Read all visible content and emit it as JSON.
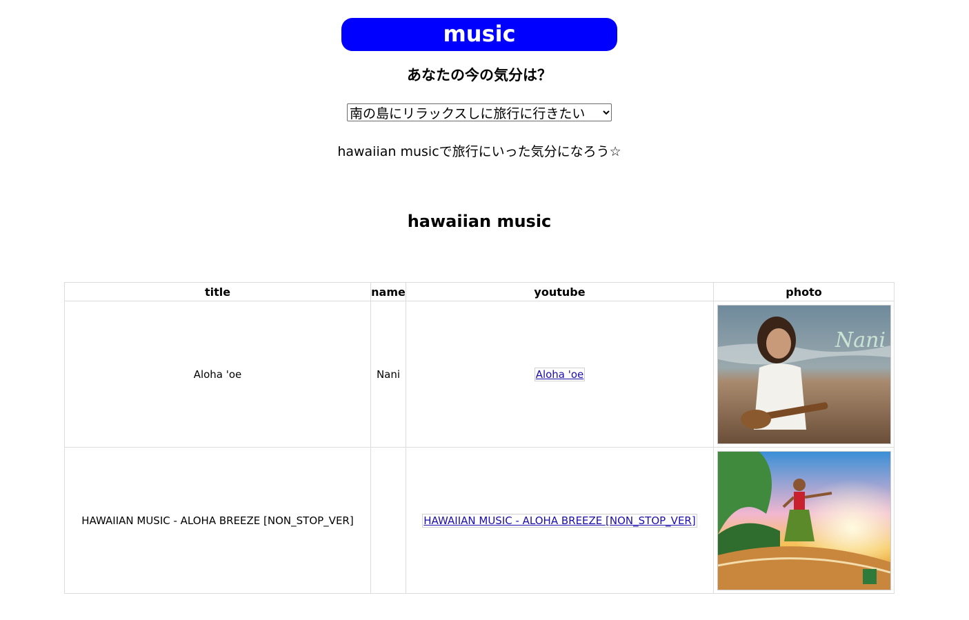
{
  "header": {
    "banner": "music",
    "question": "あなたの今の気分は？",
    "mood_select_value": "南の島にリラックスしに旅行に行きたい",
    "message": "hawaiian musicで旅行にいった気分になろう☆",
    "section_title": "hawaiian music"
  },
  "table": {
    "columns": [
      "title",
      "name",
      "youtube",
      "photo"
    ],
    "rows": [
      {
        "title": "Aloha 'oe",
        "name": "Nani",
        "youtube": "Aloha 'oe",
        "photo_caption": "Nani"
      },
      {
        "title": "HAWAIIAN MUSIC - ALOHA BREEZE [NON_STOP_VER]",
        "name": "",
        "youtube": "HAWAIIAN MUSIC - ALOHA BREEZE [NON_STOP_VER]"
      }
    ]
  },
  "colors": {
    "banner_bg": "#0000ff",
    "link": "#1a0dab",
    "border": "#dcdcdc"
  }
}
